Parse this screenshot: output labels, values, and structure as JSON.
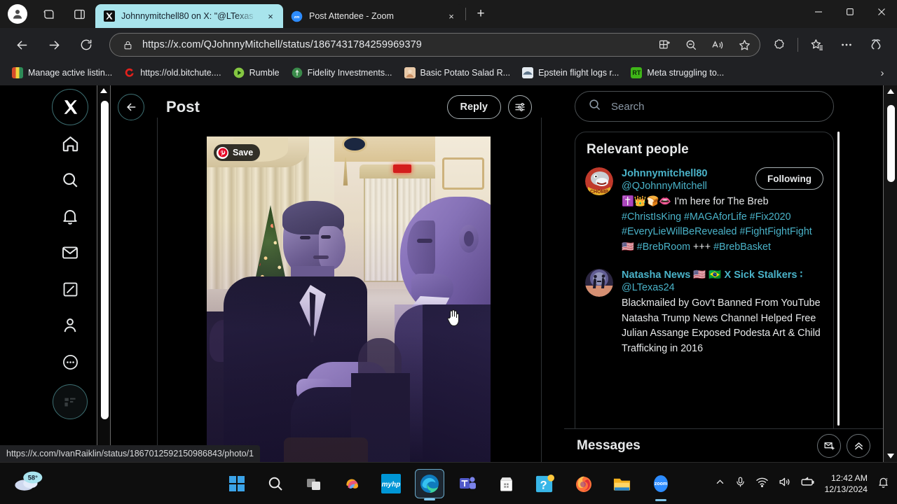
{
  "browser": {
    "tabs": [
      {
        "title": "Johnnymitchell80 on X: \"@LTexas",
        "favicon": "x-logo-icon",
        "active": true,
        "close_label": "×"
      },
      {
        "title": "Post Attendee - Zoom",
        "favicon": "zoom-icon",
        "active": false,
        "close_label": "×"
      }
    ],
    "new_tab_label": "+",
    "window_controls": {
      "minimize": "─",
      "maximize": "❐",
      "close": "✕"
    },
    "address": {
      "url": "https://x.com/QJohnnyMitchell/status/1867431784259969379",
      "lock_icon": "lock-icon"
    },
    "toolbar_icons": [
      "back-icon",
      "forward-icon",
      "refresh-icon",
      "split-screen-icon",
      "zoom-out-icon",
      "read-aloud-icon",
      "favorite-star-icon",
      "browser-essentials-icon",
      "favorites-list-icon",
      "settings-more-icon",
      "copilot-icon"
    ],
    "bookmarks": [
      {
        "label": "Manage active listin...",
        "icon_color": "#c0392b"
      },
      {
        "label": "https://old.bitchute....",
        "icon_color": "#e2211c"
      },
      {
        "label": "Rumble",
        "icon_color": "#85c742"
      },
      {
        "label": "Fidelity Investments...",
        "icon_color": "#3a8a4a"
      },
      {
        "label": "Basic Potato Salad R...",
        "icon_color": "#d9b38c"
      },
      {
        "label": "Epstein flight logs r...",
        "icon_color": "#b9c6d2"
      },
      {
        "label": "Meta struggling to...",
        "icon_color": "#3fb618"
      }
    ],
    "bookmarks_overflow": "›",
    "status_url": "https://x.com/IvanRaiklin/status/1867012592150986843/photo/1"
  },
  "x": {
    "rail": [
      {
        "name": "x-logo",
        "label": "X"
      },
      {
        "name": "home",
        "label": "Home"
      },
      {
        "name": "explore-search",
        "label": "Explore"
      },
      {
        "name": "notifications",
        "label": "Notifications"
      },
      {
        "name": "messages",
        "label": "Messages"
      },
      {
        "name": "grok",
        "label": "Grok"
      },
      {
        "name": "profile",
        "label": "Profile"
      },
      {
        "name": "more",
        "label": "More"
      }
    ],
    "header": {
      "back_icon": "arrow-left-icon",
      "title": "Post",
      "reply_label": "Reply",
      "settings_icon": "sliders-icon"
    },
    "media": {
      "pinterest_save_label": "Save",
      "pinterest_icon": "pinterest-icon",
      "alt": "Two men in dark suits speaking closely in an ornate gold and cream ballroom with a lit Christmas tree and purple stage lighting"
    },
    "search": {
      "placeholder": "Search",
      "icon": "search-icon"
    },
    "relevant_people": {
      "title": "Relevant people",
      "people": [
        {
          "name": "Johnnymitchell80",
          "handle": "@QJohnnyMitchell",
          "follow_label": "Following",
          "bio_emoji": "✝️👑🍞👄",
          "bio_text": " I'm here for The Breb ",
          "bio_tags": "#ChristIsKing #MAGAforLife #Fix2020 #EveryLieWillBeRevealed #FightFightFight",
          "bio_flag": " 🇺🇸 ",
          "bio_tags2": "#BrebRoom",
          "bio_plus": " +++ ",
          "bio_tags3": "#BrebBasket"
        },
        {
          "name": "Natasha News 🇺🇸 🇧🇷 X Sick Stalkers ∶",
          "handle": "@LTexas24",
          "bio_text": "Blackmailed by Gov't Banned From YouTube Natasha Trump News Channel Helped Free Julian Assange Exposed Podesta Art & Child Trafficking in 2016"
        }
      ]
    },
    "messages": {
      "title": "Messages",
      "new_message_icon": "new-message-icon",
      "expand_icon": "chevron-up-icon"
    }
  },
  "taskbar": {
    "weather": {
      "temperature": "58°",
      "icon": "cloud-icon"
    },
    "apps": [
      {
        "name": "start",
        "label": "Start"
      },
      {
        "name": "search",
        "label": "Search"
      },
      {
        "name": "task-view",
        "label": "Task View"
      },
      {
        "name": "copilot",
        "label": "Copilot"
      },
      {
        "name": "myhp",
        "label": "myHP"
      },
      {
        "name": "edge",
        "label": "Microsoft Edge",
        "active": true,
        "running": true
      },
      {
        "name": "teams",
        "label": "Microsoft Teams"
      },
      {
        "name": "store",
        "label": "Microsoft Store"
      },
      {
        "name": "help",
        "label": "Get Help"
      },
      {
        "name": "firefox",
        "label": "Firefox"
      },
      {
        "name": "file-explorer",
        "label": "File Explorer"
      },
      {
        "name": "zoom",
        "label": "Zoom",
        "running": true
      }
    ],
    "tray": {
      "overflow_icon": "chevron-up-icon",
      "mic_icon": "microphone-icon",
      "wifi_icon": "wifi-icon",
      "volume_icon": "speaker-icon",
      "battery_icon": "battery-icon",
      "time": "12:42 AM",
      "date": "12/13/2024",
      "notification_icon": "notification-bell-icon"
    }
  },
  "colors": {
    "accent_blue": "#4ab3c9",
    "tab_active_bg": "#a8e4ec",
    "page_bg": "#000000",
    "chrome_bg": "#202124"
  }
}
